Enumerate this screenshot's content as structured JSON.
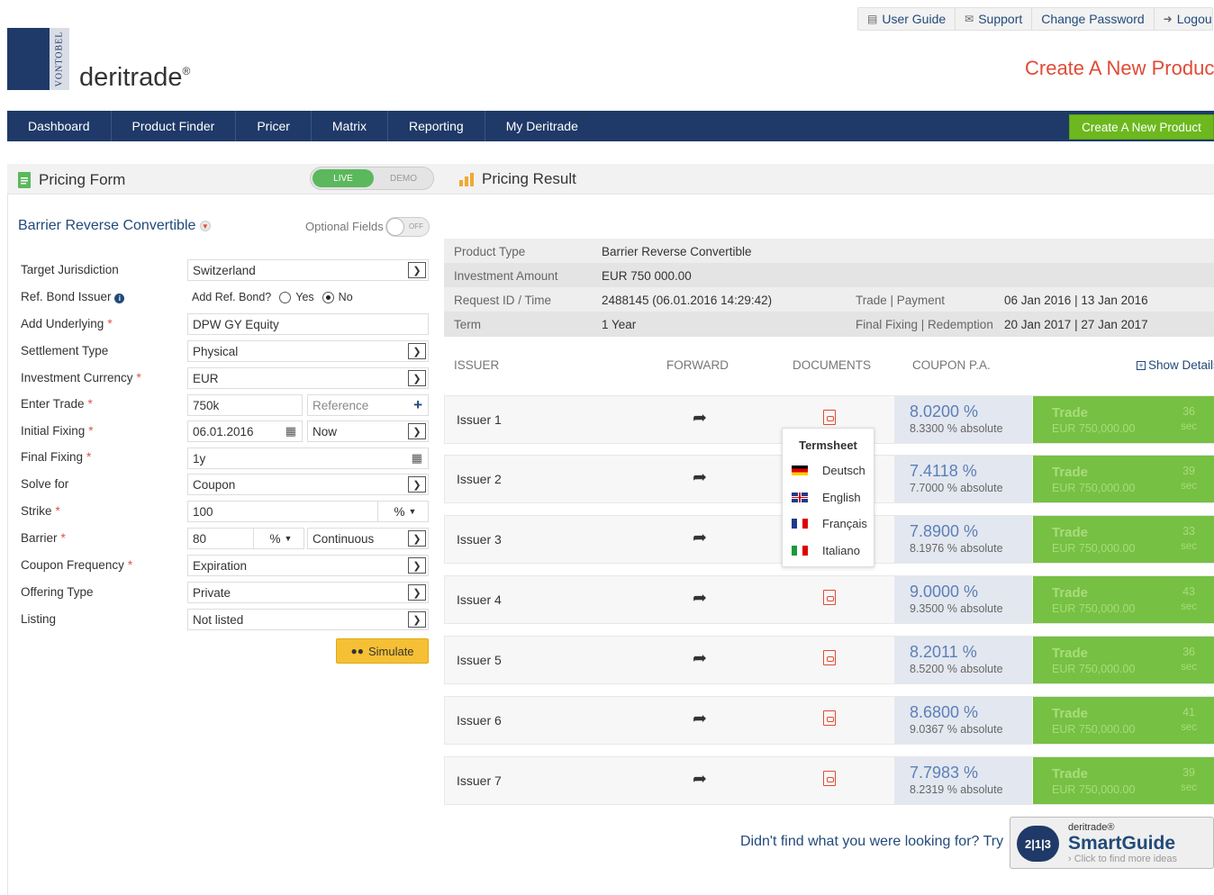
{
  "toplinks": {
    "user_guide": "User Guide",
    "support": "Support",
    "change_password": "Change Password",
    "logout": "Logou"
  },
  "logo": {
    "brand": "VONTOBEL",
    "name": "deritrade",
    "reg": "®"
  },
  "page_title": "Create A New Produc",
  "nav": {
    "items": [
      "Dashboard",
      "Product Finder",
      "Pricer",
      "Matrix",
      "Reporting",
      "My Deritrade"
    ],
    "create": "Create A New Product"
  },
  "pricing_form": {
    "title": "Pricing Form",
    "live": "LIVE",
    "demo": "DEMO"
  },
  "pricing_result": {
    "title": "Pricing Result"
  },
  "form": {
    "product": "Barrier Reverse Convertible",
    "optional_fields": "Optional Fields",
    "optional_state": "OFF",
    "labels": {
      "jurisdiction": "Target Jurisdiction",
      "bond_issuer": "Ref. Bond Issuer",
      "underlying": "Add Underlying",
      "settlement": "Settlement Type",
      "currency": "Investment Currency",
      "trade": "Enter Trade",
      "initial_fixing": "Initial Fixing",
      "final_fixing": "Final Fixing",
      "solve": "Solve for",
      "strike": "Strike",
      "barrier": "Barrier",
      "coupon_freq": "Coupon Frequency",
      "offering": "Offering Type",
      "listing": "Listing"
    },
    "values": {
      "jurisdiction": "Switzerland",
      "add_ref_bond": "Add Ref. Bond?",
      "yes": "Yes",
      "no": "No",
      "underlying": "DPW GY Equity",
      "settlement": "Physical",
      "currency": "EUR",
      "trade": "750k",
      "reference": "Reference",
      "initial_fixing": "06.01.2016",
      "initial_time": "Now",
      "final_fixing": "1y",
      "solve": "Coupon",
      "strike": "100",
      "strike_unit": "%",
      "barrier": "80",
      "barrier_unit": "%",
      "barrier_type": "Continuous",
      "coupon_freq": "Expiration",
      "offering": "Private",
      "listing": "Not listed"
    },
    "required_mark": "*",
    "simulate": "Simulate"
  },
  "result_info": {
    "product_type_k": "Product Type",
    "product_type_v": "Barrier Reverse Convertible",
    "amount_k": "Investment Amount",
    "amount_v": "EUR 750 000.00",
    "request_k": "Request ID / Time",
    "request_v": "2488145 (06.01.2016 14:29:42)",
    "trade_k": "Trade | Payment",
    "trade_v": "06 Jan 2016 | 13 Jan 2016",
    "term_k": "Term",
    "term_v": "1 Year",
    "fixing_k": "Final Fixing | Redemption",
    "fixing_v": "20 Jan 2017 | 27 Jan 2017"
  },
  "columns": {
    "issuer": "ISSUER",
    "forward": "FORWARD",
    "documents": "DOCUMENTS",
    "coupon": "COUPON P.A.",
    "show_details": "Show Details"
  },
  "issuers": [
    {
      "name": "Issuer 1",
      "coupon": "8.0200 %",
      "absolute": "8.3300 % absolute",
      "trade": "Trade",
      "amount": "EUR 750,000.00",
      "secs": "36",
      "unit": "sec"
    },
    {
      "name": "Issuer 2",
      "coupon": "7.4118 %",
      "absolute": "7.7000 % absolute",
      "trade": "Trade",
      "amount": "EUR 750,000.00",
      "secs": "39",
      "unit": "sec"
    },
    {
      "name": "Issuer 3",
      "coupon": "7.8900 %",
      "absolute": "8.1976 % absolute",
      "trade": "Trade",
      "amount": "EUR 750,000.00",
      "secs": "33",
      "unit": "sec"
    },
    {
      "name": "Issuer 4",
      "coupon": "9.0000 %",
      "absolute": "9.3500 % absolute",
      "trade": "Trade",
      "amount": "EUR 750,000.00",
      "secs": "43",
      "unit": "sec"
    },
    {
      "name": "Issuer 5",
      "coupon": "8.2011 %",
      "absolute": "8.5200 % absolute",
      "trade": "Trade",
      "amount": "EUR 750,000.00",
      "secs": "36",
      "unit": "sec"
    },
    {
      "name": "Issuer 6",
      "coupon": "8.6800 %",
      "absolute": "9.0367 % absolute",
      "trade": "Trade",
      "amount": "EUR 750,000.00",
      "secs": "41",
      "unit": "sec"
    },
    {
      "name": "Issuer 7",
      "coupon": "7.7983 %",
      "absolute": "8.2319 % absolute",
      "trade": "Trade",
      "amount": "EUR 750,000.00",
      "secs": "39",
      "unit": "sec"
    }
  ],
  "termsheet": {
    "title": "Termsheet",
    "languages": [
      "Deutsch",
      "English",
      "Français",
      "Italiano"
    ]
  },
  "smartguide": {
    "question": "Didn't find what you were looking for? Try",
    "small": "deritrade®",
    "name": "SmartGuide",
    "hint": "› Click to find more ideas",
    "badge": "2|1|3"
  },
  "colors": {
    "navy": "#1f3a68",
    "green": "#76c043",
    "accent_red": "#e04b36",
    "yellow": "#f6c035"
  }
}
